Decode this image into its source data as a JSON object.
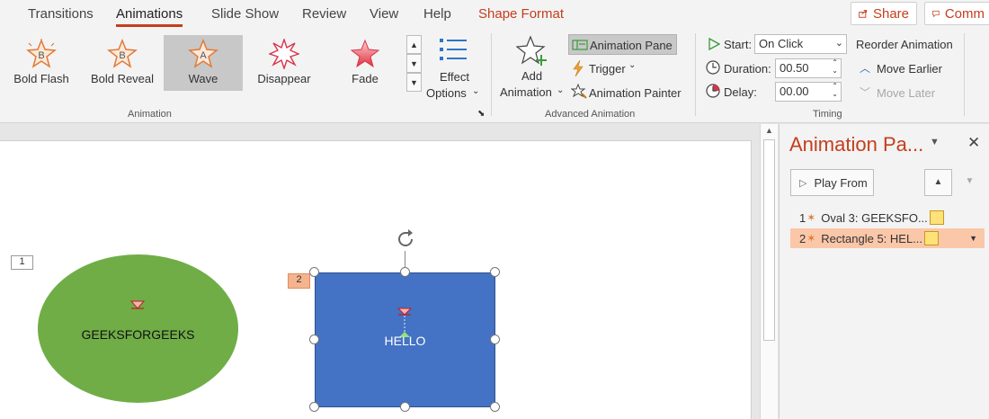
{
  "tabs": [
    "Transitions",
    "Animations",
    "Slide Show",
    "Review",
    "View",
    "Help",
    "Shape Format"
  ],
  "active_tab": "Animations",
  "top_buttons": {
    "share": "Share",
    "comments": "Comm"
  },
  "gallery": {
    "items": [
      {
        "label": "Bold Flash",
        "letter": "B"
      },
      {
        "label": "Bold Reveal",
        "letter": "B"
      },
      {
        "label": "Wave",
        "letter": "A"
      },
      {
        "label": "Disappear",
        "letter": ""
      },
      {
        "label": "Fade",
        "letter": ""
      }
    ],
    "selected": "Wave"
  },
  "effect_options": {
    "line1": "Effect",
    "line2": "Options"
  },
  "animation_group_label": "Animation",
  "advanced": {
    "add_line1": "Add",
    "add_line2": "Animation",
    "animation_pane": "Animation Pane",
    "trigger": "Trigger",
    "painter": "Animation Painter",
    "label": "Advanced Animation"
  },
  "timing": {
    "start_label": "Start:",
    "start_value": "On Click",
    "duration_label": "Duration:",
    "duration_value": "00.50",
    "delay_label": "Delay:",
    "delay_value": "00.00",
    "label": "Timing"
  },
  "reorder": {
    "title": "Reorder Animation",
    "earlier": "Move Earlier",
    "later": "Move Later"
  },
  "slide": {
    "tag1": "1",
    "tag2": "2",
    "oval_text": "GEEKSFORGEEKS",
    "rect_text": "HELLO"
  },
  "pane": {
    "title": "Animation Pa...",
    "play_from": "Play From",
    "items": [
      {
        "num": "1",
        "label": "Oval 3: GEEKSFO..."
      },
      {
        "num": "2",
        "label": "Rectangle 5: HEL..."
      }
    ]
  },
  "colors": {
    "accent": "#c43e1c",
    "oval_fill": "#70ad47",
    "rect_fill": "#4472c4",
    "selected_row": "#fbc7a9"
  }
}
